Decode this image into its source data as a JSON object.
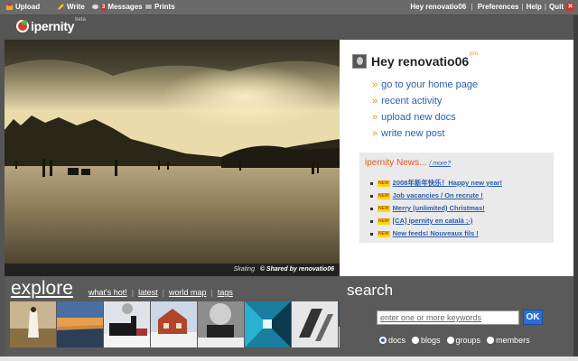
{
  "topbar": {
    "items": [
      {
        "label": "Upload",
        "icon": "upload-icon"
      },
      {
        "label": "Write",
        "icon": "pencil-icon"
      },
      {
        "label": "Messages",
        "icon": "messages-icon",
        "badge": "3"
      },
      {
        "label": "Prints",
        "icon": "prints-icon"
      }
    ],
    "greeting": "Hey renovatio06",
    "preferences": "Preferences",
    "help": "Help",
    "quit": "Quit"
  },
  "logo": {
    "text": "ipernity",
    "tag": "beta"
  },
  "photo": {
    "caption_title": "Skating",
    "caption_credit": "© Shared by renovatio06"
  },
  "user": {
    "greeting": "Hey renovatio06",
    "badge": "pro"
  },
  "actions": [
    "go to your home page",
    "recent activity",
    "upload new docs",
    "write new post"
  ],
  "news": {
    "title": "ipernity News...",
    "more": "/ more?",
    "badge": "NEW",
    "items": [
      "2008年新年快乐！Happy new year!",
      "Job vacancies / On recrute !",
      "Merry (unlimited) Christmas!",
      "[CA] ipernity en català ;-)",
      "New feeds! Nouveaux fils !"
    ]
  },
  "explore": {
    "title": "explore",
    "links": [
      "what's hot!",
      "latest",
      "world map",
      "tags"
    ]
  },
  "search": {
    "title": "search",
    "placeholder": "enter one or more keywords",
    "button": "OK",
    "options": [
      "docs",
      "blogs",
      "groups",
      "members"
    ],
    "selected": "docs"
  },
  "colors": {
    "accent_orange": "#f39200",
    "link_blue": "#2a5db0",
    "news_orange": "#e35a1d",
    "ok_blue": "#2a6fd6"
  }
}
